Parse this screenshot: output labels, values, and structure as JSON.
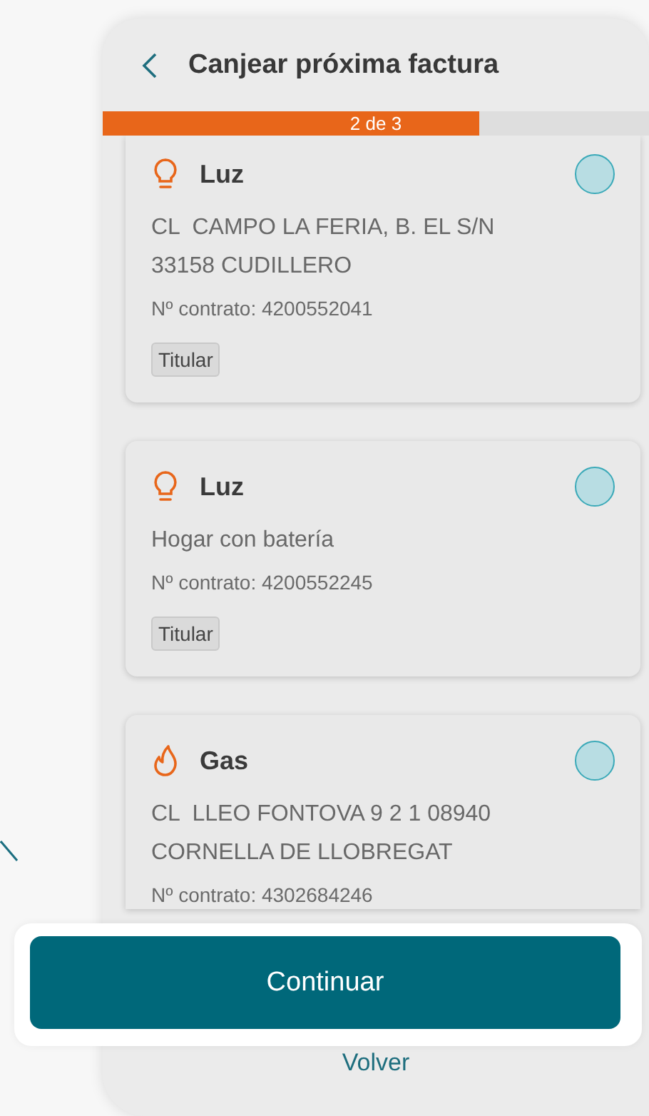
{
  "header": {
    "title": "Canjear próxima factura"
  },
  "progress": {
    "label": "2 de 3",
    "level": 0.69
  },
  "contracts": [
    {
      "kind": "electricity",
      "title": "Luz",
      "address": [
        "CL  CAMPO LA FERIA, B. EL S/N",
        "33158 CUDILLERO"
      ],
      "contract": "Nº contrato: 4200552041",
      "tag": "Titular",
      "selected": false
    },
    {
      "kind": "electricity",
      "title": "Luz",
      "address": [
        "Hogar con batería"
      ],
      "contract": "Nº contrato: 4200552245",
      "tag": "Titular",
      "selected": false
    },
    {
      "kind": "gas",
      "title": "Gas",
      "address": [
        "CL  LLEO FONTOVA 9 2 1 08940",
        "CORNELLA DE LLOBREGAT"
      ],
      "contract": "Nº contrato: 4302684246",
      "selected": false
    }
  ],
  "primary_button": "Continuar",
  "secondary_link": "Volver"
}
